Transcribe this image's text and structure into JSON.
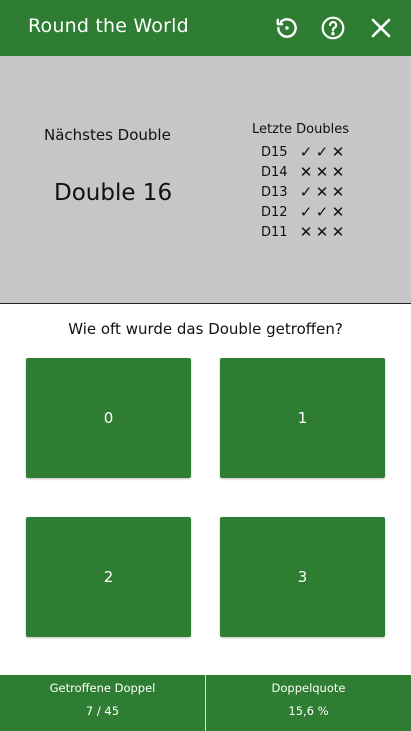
{
  "appbar": {
    "title": "Round the World",
    "icons": [
      "history-icon",
      "help-icon",
      "close-icon"
    ]
  },
  "next_double": {
    "label": "Nächstes Double",
    "value": "Double 16"
  },
  "recent": {
    "title": "Letzte Doubles",
    "rows": [
      {
        "double": "D15",
        "marks": [
          "✓",
          "✓",
          "✕"
        ]
      },
      {
        "double": "D14",
        "marks": [
          "✕",
          "✕",
          "✕"
        ]
      },
      {
        "double": "D13",
        "marks": [
          "✓",
          "✕",
          "✕"
        ]
      },
      {
        "double": "D12",
        "marks": [
          "✓",
          "✓",
          "✕"
        ]
      },
      {
        "double": "D11",
        "marks": [
          "✕",
          "✕",
          "✕"
        ]
      }
    ]
  },
  "question": "Wie oft wurde das Double getroffen?",
  "answers": [
    "0",
    "1",
    "2",
    "3"
  ],
  "footer": {
    "hits_label": "Getroffene Doppel",
    "hits_value": "7 / 45",
    "rate_label": "Doppelquote",
    "rate_value": "15,6 %"
  },
  "colors": {
    "primary": "#2e7d32",
    "panel": "#c6c6c6"
  }
}
